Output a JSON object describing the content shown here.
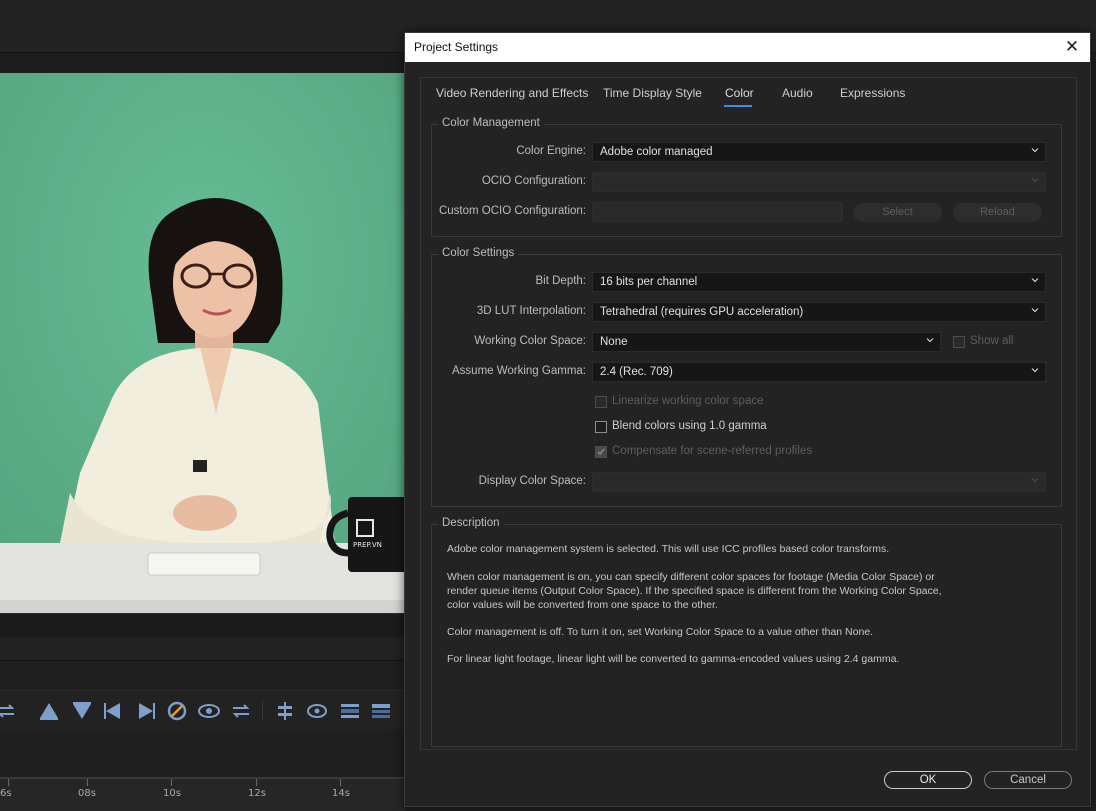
{
  "dialog": {
    "title": "Project Settings",
    "close_glyph": "✕",
    "tabs": [
      {
        "label": "Video Rendering and Effects",
        "active": false
      },
      {
        "label": "Time Display Style",
        "active": false
      },
      {
        "label": "Color",
        "active": true
      },
      {
        "label": "Audio",
        "active": false
      },
      {
        "label": "Expressions",
        "active": false
      }
    ],
    "color_management": {
      "title": "Color Management",
      "color_engine_label": "Color Engine:",
      "color_engine_value": "Adobe color managed",
      "ocio_config_label": "OCIO Configuration:",
      "ocio_config_value": "",
      "custom_ocio_label": "Custom OCIO Configuration:",
      "custom_ocio_value": "",
      "select_label": "Select",
      "reload_label": "Reload"
    },
    "color_settings": {
      "title": "Color Settings",
      "bit_depth_label": "Bit Depth:",
      "bit_depth_value": "16 bits per channel",
      "lut_label": "3D LUT Interpolation:",
      "lut_value": "Tetrahedral (requires GPU acceleration)",
      "working_space_label": "Working Color Space:",
      "working_space_value": "None",
      "show_all_label": "Show all",
      "gamma_label": "Assume Working Gamma:",
      "gamma_value": "2.4 (Rec. 709)",
      "linearize_label": "Linearize working color space",
      "blend_label": "Blend colors using 1.0 gamma",
      "compensate_label": "Compensate for scene-referred profiles",
      "display_space_label": "Display Color Space:",
      "display_space_value": ""
    },
    "description": {
      "title": "Description",
      "p1": "Adobe color management system is selected. This will use ICC profiles based color transforms.",
      "p2a": "When color management is on, you can specify different color spaces for footage (Media Color Space) or",
      "p2b": "render queue items (Output Color Space). If the specified space is different from the Working Color Space,",
      "p2c": "color values will be converted from one space to the other.",
      "p3": "Color management is off. To turn it on, set Working Color Space to a value other than None.",
      "p4": "For linear light footage, linear light will be converted to gamma-encoded values using 2.4 gamma."
    },
    "ok_label": "OK",
    "cancel_label": "Cancel"
  },
  "background_app": {
    "mug_text": "PREP.VN",
    "ruler_labels": [
      "6s",
      "08s",
      "10s",
      "12s",
      "14s"
    ],
    "toolbar_icons": [
      "swap-icon",
      "triangle-up-icon",
      "triangle-down-icon",
      "step-back-icon",
      "step-forward-icon",
      "no-entry-icon",
      "eye-loop-icon",
      "swap-arrows-icon",
      "center-icon",
      "eye-target-icon",
      "layer-down-icon",
      "layer-up-icon"
    ]
  },
  "colors": {
    "accent": "#3a8ee6",
    "green_screen": "#5fb38d",
    "dialog_bg": "#232323"
  }
}
